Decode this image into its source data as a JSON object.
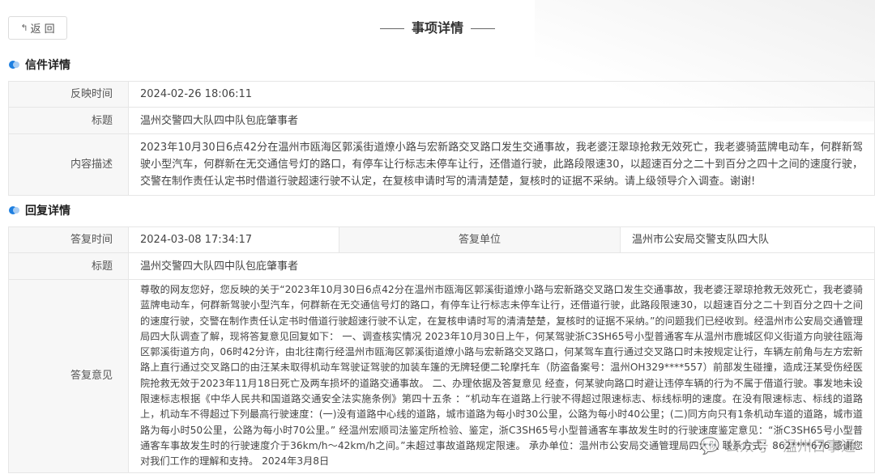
{
  "header": {
    "back_label": "返 回",
    "back_icon": "reply-arrow-icon",
    "title": "事项详情"
  },
  "letter": {
    "section_title": "信件详情",
    "rows": {
      "time_label": "反映时间",
      "time_value": "2024-02-26 18:06:11",
      "title_label": "标题",
      "title_value": "温州交警四大队四中队包庇肇事者",
      "desc_label": "内容描述",
      "desc_value": "2023年10月30日6点42分在温州市瓯海区郭溪街道燎小路与宏新路交叉路口发生交通事故，我老婆汪翠琼抢救无效死亡，我老婆骑蓝牌电动车，何群新驾驶小型汽车，何群新在无交通信号灯的路口，有停车让行标志未停车让行，还借道行驶，此路段限速30，以超速百分之二十到百分之四十之间的速度行驶，交警在制作责任认定书时借道行驶超速行驶不认定，在复核申请时写的清清楚楚，复核时的证据不采纳。请上级领导介入调查。谢谢!"
    }
  },
  "reply": {
    "section_title": "回复详情",
    "rows": {
      "time_label": "答复时间",
      "time_value": "2024-03-08 17:34:17",
      "unit_label": "答复单位",
      "unit_value": "温州市公安局交警支队四大队",
      "title_label": "标题",
      "title_value": "温州交警四大队四中队包庇肇事者",
      "opinion_label": "答复意见",
      "opinion_value": "尊敬的网友您好，您反映的关于“2023年10月30日6点42分在温州市瓯海区郭溪街道燎小路与宏新路交叉路口发生交通事故，我老婆汪翠琼抢救无效死亡，我老婆骑蓝牌电动车，何群新驾驶小型汽车，何群新在无交通信号灯的路口，有停车让行标志未停车让行，还借道行驶，此路段限速30，以超速百分之二十到百分之四十之间的速度行驶，交警在制作责任认定书时借道行驶超速行驶不认定，在复核申请时写的清清楚楚，复核时的证据不采纳。”的问题我们已经收到。经温州市公安局交通管理局四大队调查了解，现将答复意见回复如下： 一、调查核实情况 2023年10月30日上午，何某驾驶浙C3SH65号小型普通客车从温州市鹿城区仰义街道方向驶往瓯海区郭溪街道方向，06时42分许，由北往南行经温州市瓯海区郭溪街道燎小路与宏新路交叉路口，何某驾车直行通过交叉路口时未按规定让行，车辆左前角与左方宏新路上直行通过交叉路口的由汪某未取得机动车驾驶证驾驶的加装车篷的无牌轻便二轮摩托车（防盗备案号：温州OH329****557）前部发生碰撞，造成汪某受伤经医院抢救无效于2023年11月18日死亡及两车损坏的道路交通事故。 二、办理依据及答复意见 经查，何某驶向路口时避让违停车辆的行为不属于借道行驶。事发地未设限速标志根据《中华人民共和国道路交通安全法实施条例》第四十五条 ：“机动车在道路上行驶不得超过限速标志、标线标明的速度。在没有限速标志、标线的道路上，机动车不得超过下列最高行驶速度：(一)没有道路中心线的道路，城市道路为每小时30公里，公路为每小时40公里；(二)同方向只有1条机动车道的道路，城市道路为每小时50公里，公路为每小时70公里。” 经温州宏顺司法鉴定所检验、鉴定，浙C3SH65号小型普通客车事故发生时的行驶速度鉴定意见：“浙C3SH65号小型普通客车事故发生时的行驶速度介于36km/h～42km/h之间。”未超过事故道路规定限速。 承办单位：温州市公安局交通管理局四大队 联系方式：862****676 感谢您对我们工作的理解和支持。 2024年3月8日"
    }
  },
  "watermark": {
    "icon": "wechat-icon",
    "text": "公众号 · 温州日事通"
  }
}
